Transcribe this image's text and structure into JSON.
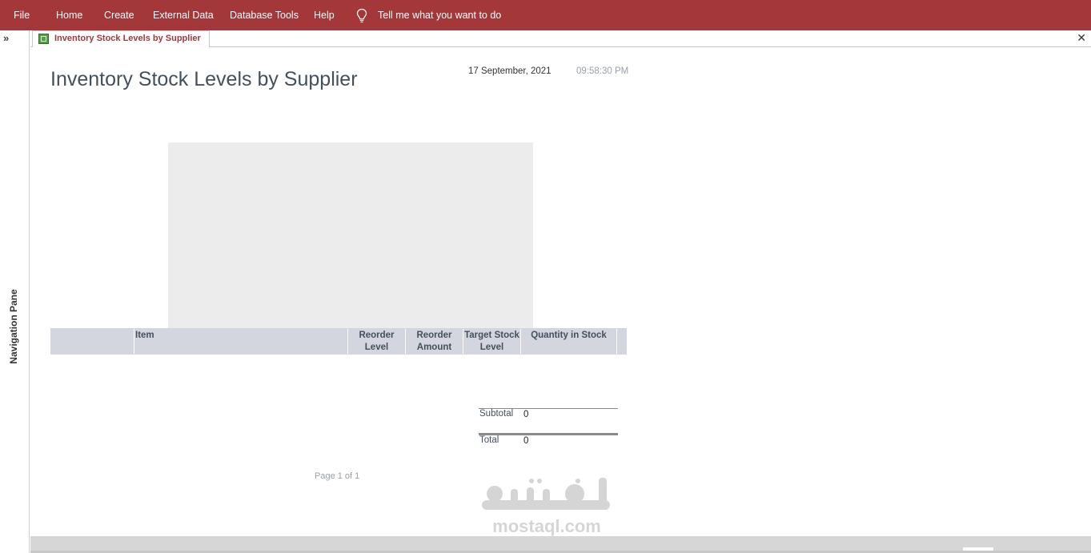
{
  "ribbon": {
    "menu": [
      "File",
      "Home",
      "Create",
      "External Data",
      "Database Tools",
      "Help"
    ],
    "tell_me": "Tell me what you want to do",
    "color": "#a4373a"
  },
  "nav_pane": {
    "toggle": "»",
    "label": "Navigation Pane"
  },
  "document_tab": {
    "label": "Inventory Stock Levels by Supplier",
    "close": "✕"
  },
  "report": {
    "title": "Inventory Stock Levels by Supplier",
    "date": "17 September, 2021",
    "time": "09:58:30 PM",
    "columns": [
      "Item",
      "Reorder Level",
      "Reorder Amount",
      "Target Stock Level",
      "Quantity in Stock"
    ],
    "subtotal_label": "Subtotal",
    "subtotal_value": "0",
    "total_label": "Total",
    "total_value": "0",
    "page_number": "Page 1 of 1"
  },
  "watermark": {
    "text": "mostaql.com"
  }
}
